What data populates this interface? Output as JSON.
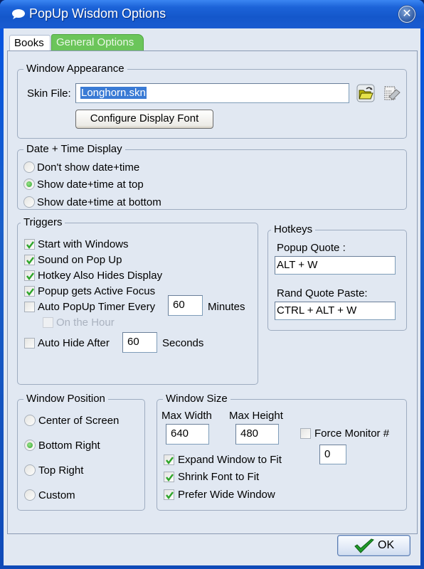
{
  "window": {
    "title": "PopUp Wisdom Options",
    "close_label": "✕"
  },
  "tabs": [
    {
      "label": "Books",
      "active": false
    },
    {
      "label": "General Options",
      "active": true
    }
  ],
  "appearance": {
    "legend": "Window Appearance",
    "skin_label": "Skin File:",
    "skin_value": "Longhorn.skn",
    "browse_icon": "folder-open-icon",
    "edit_icon": "skin-editor-icon",
    "font_button": "Configure Display Font"
  },
  "datetime": {
    "legend": "Date + Time Display",
    "options": [
      {
        "label": "Don't show date+time",
        "selected": false
      },
      {
        "label": "Show date+time at top",
        "selected": true
      },
      {
        "label": "Show date+time at bottom",
        "selected": false
      }
    ]
  },
  "triggers": {
    "legend": "Triggers",
    "checks": [
      {
        "label": "Start with Windows",
        "checked": true
      },
      {
        "label": "Sound on Pop Up",
        "checked": true
      },
      {
        "label": "Hotkey Also Hides Display",
        "checked": true
      },
      {
        "label": "Popup gets Active Focus",
        "checked": true
      }
    ],
    "timer": {
      "label": "Auto PopUp Timer Every",
      "checked": false,
      "value": "60",
      "unit": "Minutes"
    },
    "on_hour": {
      "label": "On the Hour",
      "checked": false,
      "disabled": true
    },
    "auto_hide": {
      "label": "Auto Hide After",
      "checked": false,
      "value": "60",
      "unit": "Seconds"
    }
  },
  "hotkeys": {
    "legend": "Hotkeys",
    "popup_label": "Popup Quote :",
    "popup_value": "ALT + W",
    "paste_label": "Rand Quote Paste:",
    "paste_value": "CTRL + ALT + W"
  },
  "position": {
    "legend": "Window Position",
    "options": [
      {
        "label": "Center of Screen",
        "selected": false
      },
      {
        "label": "Bottom Right",
        "selected": true
      },
      {
        "label": "Top Right",
        "selected": false
      },
      {
        "label": "Custom",
        "selected": false
      }
    ]
  },
  "size": {
    "legend": "Window Size",
    "max_width_label": "Max Width",
    "max_width_value": "640",
    "max_height_label": "Max Height",
    "max_height_value": "480",
    "force_monitor_label": "Force Monitor #",
    "force_monitor_checked": false,
    "force_monitor_value": "0",
    "checks": [
      {
        "label": "Expand Window to Fit",
        "checked": true
      },
      {
        "label": "Shrink Font to Fit",
        "checked": true
      },
      {
        "label": "Prefer Wide Window",
        "checked": true
      }
    ]
  },
  "footer": {
    "ok_label": "OK"
  },
  "colors": {
    "titlebar": "#1c63d8",
    "active_tab": "#6bc55a",
    "panel": "#e1e8f2",
    "selection": "#3a7bd5",
    "check": "#2ea52a"
  }
}
